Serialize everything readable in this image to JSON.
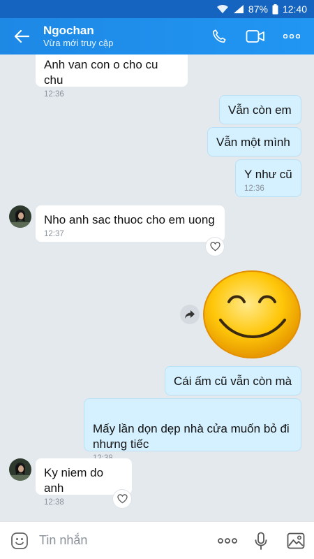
{
  "status_bar": {
    "battery": "87%",
    "time": "12:40"
  },
  "header": {
    "name": "Ngochan",
    "status": "Vừa mới truy cập"
  },
  "messages": [
    {
      "dir": "in",
      "text": "Anh van con o cho cu chu",
      "time": "12:36"
    },
    {
      "dir": "out",
      "text": "Vẫn còn em",
      "time": ""
    },
    {
      "dir": "out",
      "text": "Vẫn một mình",
      "time": ""
    },
    {
      "dir": "out",
      "text": "Y như cũ",
      "time": "12:36"
    },
    {
      "dir": "in",
      "text": "Nho anh sac thuoc cho em uong",
      "time": "12:37"
    },
    {
      "dir": "out",
      "type": "sticker",
      "sticker": "smiling-face-sticker"
    },
    {
      "dir": "out",
      "text": "Cái ấm cũ vẫn còn mà",
      "time": ""
    },
    {
      "dir": "out",
      "text": "Mấy lần dọn dẹp nhà cửa muốn bỏ đi\nnhưng tiếc",
      "time": "12:38"
    },
    {
      "dir": "in",
      "text": "Ky niem do anh",
      "time": "12:38"
    }
  ],
  "input": {
    "placeholder": "Tin nhắn"
  },
  "colors": {
    "header": "#2196f3",
    "status_bar": "#1565c0",
    "out_bubble": "#d5f1ff",
    "in_bubble": "#ffffff",
    "chat_bg": "#e4e9ee"
  }
}
